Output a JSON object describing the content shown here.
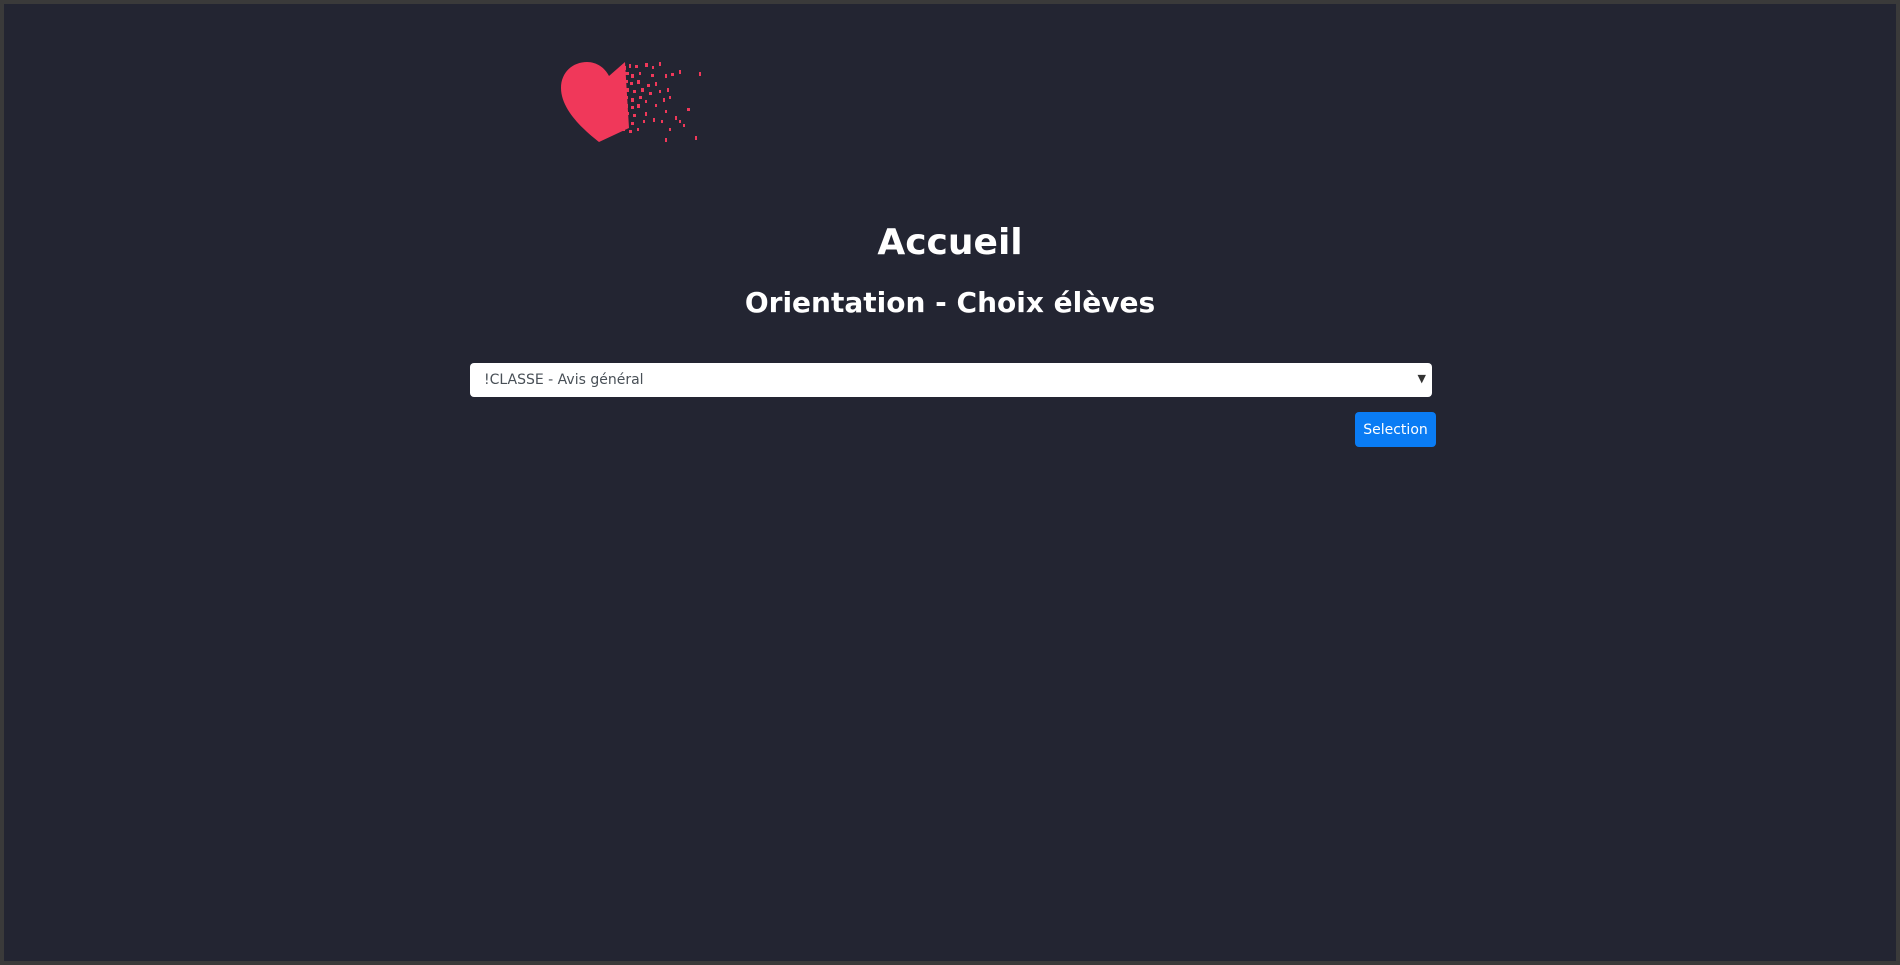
{
  "header": {
    "logo_icon": "heart-pixel-dissolve-icon",
    "logo_color": "#f0385a"
  },
  "main": {
    "title": "Accueil",
    "subtitle": "Orientation - Choix élèves"
  },
  "form": {
    "class_select": {
      "selected": "!CLASSE - Avis général"
    },
    "submit_label": "Selection"
  },
  "colors": {
    "background": "#232532",
    "button": "#0a7cf4"
  }
}
